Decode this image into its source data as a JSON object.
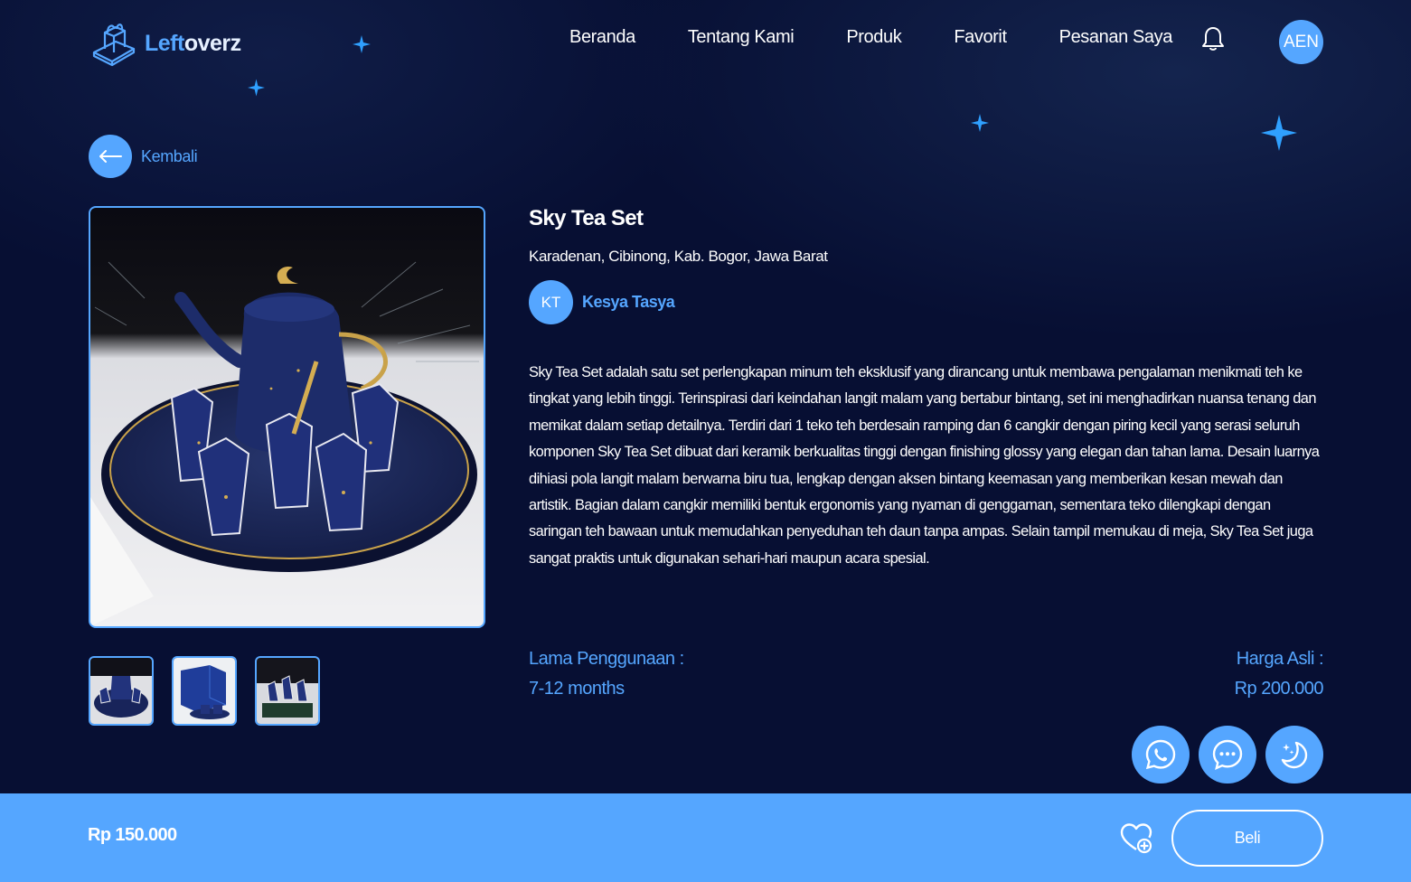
{
  "brand": {
    "name_part1": "Left",
    "name_part2": "overz"
  },
  "nav": {
    "items": [
      "Beranda",
      "Tentang Kami",
      "Produk",
      "Favorit",
      "Pesanan Saya"
    ]
  },
  "user": {
    "initials": "AEN"
  },
  "back": {
    "label": "Kembali"
  },
  "product": {
    "title": "Sky Tea Set",
    "location": "Karadenan, Cibinong, Kab. Bogor, Jawa Barat",
    "seller": {
      "initials": "KT",
      "name": "Kesya Tasya"
    },
    "description": "Sky Tea Set adalah satu set perlengkapan minum teh eksklusif yang dirancang untuk membawa pengalaman menikmati teh ke tingkat yang lebih tinggi. Terinspirasi dari keindahan langit malam yang bertabur bintang, set ini menghadirkan nuansa tenang dan memikat dalam setiap detailnya. Terdiri dari 1 teko teh berdesain ramping dan 6 cangkir dengan piring kecil yang serasi seluruh komponen Sky Tea Set dibuat dari keramik berkualitas tinggi dengan finishing glossy yang elegan dan tahan lama. Desain luarnya dihiasi pola langit malam berwarna biru tua, lengkap dengan aksen bintang keemasan yang memberikan kesan mewah dan artistik. Bagian dalam cangkir memiliki bentuk ergonomis yang nyaman di genggaman, sementara teko dilengkapi dengan saringan teh bawaan untuk memudahkan penyeduhan teh daun tanpa ampas. Selain tampil memukau di meja, Sky Tea Set juga sangat praktis untuk digunakan sehari-hari maupun acara spesial.",
    "usage_label": "Lama Penggunaan :",
    "usage_value": "7-12 months",
    "original_price_label": "Harga Asli :",
    "original_price_value": "Rp 200.000",
    "price": "Rp 150.000"
  },
  "actions": {
    "buy_label": "Beli"
  },
  "icons": [
    "logo-icon",
    "bell-icon",
    "arrow-left-icon",
    "whatsapp-icon",
    "chat-icon",
    "moon-stars-icon",
    "heart-plus-icon",
    "sparkle-star-icon"
  ],
  "colors": {
    "accent": "#55a6ff",
    "background": "#070f33",
    "text": "#ffffff"
  }
}
